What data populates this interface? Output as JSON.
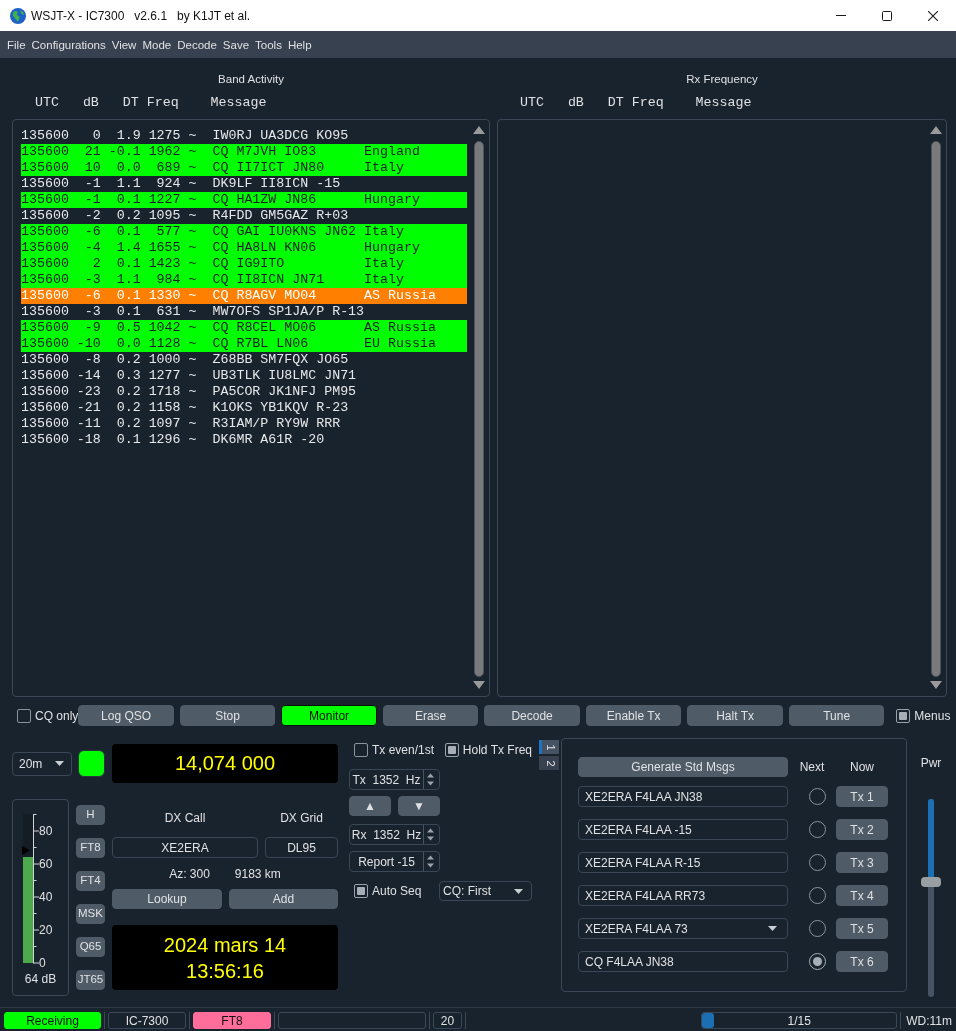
{
  "window": {
    "title": "WSJT-X - IC7300   v2.6.1   by K1JT et al."
  },
  "menu": [
    "File",
    "Configurations",
    "View",
    "Mode",
    "Decode",
    "Save",
    "Tools",
    "Help"
  ],
  "band_activity": {
    "title": "Band Activity",
    "columns": [
      "UTC",
      "dB",
      "DT",
      "Freq",
      "Message"
    ],
    "rows": [
      {
        "utc": "135600",
        "db": "0",
        "dt": "1.9",
        "freq": "1275",
        "mode": "~",
        "message": "IW0RJ UA3DCG KO95"
      },
      {
        "utc": "135600",
        "db": "21",
        "dt": "-0.1",
        "freq": "1962",
        "mode": "~",
        "message": "CQ M7JVH IO83",
        "country": "England",
        "color": "#00ff00"
      },
      {
        "utc": "135600",
        "db": "10",
        "dt": "0.0",
        "freq": "689",
        "mode": "~",
        "message": "CQ II7ICT JN80",
        "country": "Italy",
        "color": "#00ff00"
      },
      {
        "utc": "135600",
        "db": "-1",
        "dt": "1.1",
        "freq": "924",
        "mode": "~",
        "message": "DK9LF II8ICN -15"
      },
      {
        "utc": "135600",
        "db": "-1",
        "dt": "0.1",
        "freq": "1227",
        "mode": "~",
        "message": "CQ HA1ZW JN86",
        "country": "Hungary",
        "color": "#00ff00"
      },
      {
        "utc": "135600",
        "db": "-2",
        "dt": "0.2",
        "freq": "1095",
        "mode": "~",
        "message": "R4FDD GM5GAZ R+03"
      },
      {
        "utc": "135600",
        "db": "-6",
        "dt": "0.1",
        "freq": "577",
        "mode": "~",
        "message": "CQ GAI IU0KNS JN62",
        "country": "Italy",
        "color": "#00ff00"
      },
      {
        "utc": "135600",
        "db": "-4",
        "dt": "1.4",
        "freq": "1655",
        "mode": "~",
        "message": "CQ HA8LN KN06",
        "country": "Hungary",
        "color": "#00ff00"
      },
      {
        "utc": "135600",
        "db": "2",
        "dt": "0.1",
        "freq": "1423",
        "mode": "~",
        "message": "CQ IG9ITO",
        "country": "Italy",
        "color": "#00ff00"
      },
      {
        "utc": "135600",
        "db": "-3",
        "dt": "1.1",
        "freq": "984",
        "mode": "~",
        "message": "CQ II8ICN JN71",
        "country": "Italy",
        "color": "#00ff00"
      },
      {
        "utc": "135600",
        "db": "-6",
        "dt": "0.1",
        "freq": "1330",
        "mode": "~",
        "message": "CQ R8AGV MO04",
        "country": "AS Russia",
        "color": "#ff8000"
      },
      {
        "utc": "135600",
        "db": "-3",
        "dt": "0.1",
        "freq": "631",
        "mode": "~",
        "message": "MW7OFS SP1JA/P R-13"
      },
      {
        "utc": "135600",
        "db": "-9",
        "dt": "0.5",
        "freq": "1042",
        "mode": "~",
        "message": "CQ R8CEL MO06",
        "country": "AS Russia",
        "color": "#00ff00"
      },
      {
        "utc": "135600",
        "db": "-10",
        "dt": "0.0",
        "freq": "1128",
        "mode": "~",
        "message": "CQ R7BL LN06",
        "country": "EU Russia",
        "color": "#00ff00"
      },
      {
        "utc": "135600",
        "db": "-8",
        "dt": "0.2",
        "freq": "1000",
        "mode": "~",
        "message": "Z68BB SM7FQX JO65"
      },
      {
        "utc": "135600",
        "db": "-14",
        "dt": "0.3",
        "freq": "1277",
        "mode": "~",
        "message": "UB3TLK IU8LMC JN71"
      },
      {
        "utc": "135600",
        "db": "-23",
        "dt": "0.2",
        "freq": "1718",
        "mode": "~",
        "message": "PA5COR JK1NFJ PM95"
      },
      {
        "utc": "135600",
        "db": "-21",
        "dt": "0.2",
        "freq": "1158",
        "mode": "~",
        "message": "K1OKS YB1KQV R-23"
      },
      {
        "utc": "135600",
        "db": "-11",
        "dt": "0.2",
        "freq": "1097",
        "mode": "~",
        "message": "R3IAM/P RY9W RRR"
      },
      {
        "utc": "135600",
        "db": "-18",
        "dt": "0.1",
        "freq": "1296",
        "mode": "~",
        "message": "DK6MR A61R -20"
      }
    ]
  },
  "rx_frequency": {
    "title": "Rx Frequency",
    "columns": [
      "UTC",
      "dB",
      "DT",
      "Freq",
      "Message"
    ]
  },
  "toolbar": {
    "cq_only": {
      "label": "CQ only",
      "checked": false
    },
    "buttons": [
      {
        "label": "Log QSO",
        "on": false
      },
      {
        "label": "Stop",
        "on": false
      },
      {
        "label": "Monitor",
        "on": true
      },
      {
        "label": "Erase",
        "on": false
      },
      {
        "label": "Decode",
        "on": false
      },
      {
        "label": "Enable Tx",
        "on": false
      },
      {
        "label": "Halt Tx",
        "on": false
      },
      {
        "label": "Tune",
        "on": false
      }
    ],
    "menus": {
      "label": "Menus",
      "checked": true
    }
  },
  "band": {
    "value": "20m"
  },
  "rig_indicator": {
    "on": true
  },
  "dial_frequency": "14,074 000",
  "signal_meter": {
    "level": 0.71,
    "scale": [
      "80",
      "60",
      "40",
      "20",
      "0"
    ],
    "reading": "64 dB"
  },
  "modes": [
    "H",
    "FT8",
    "FT4",
    "MSK",
    "Q65",
    "JT65"
  ],
  "dx": {
    "call_label": "DX Call",
    "grid_label": "DX Grid",
    "call": "XE2ERA",
    "grid": "DL95",
    "azimuth": "Az: 300",
    "distance": "9183 km",
    "lookup": "Lookup",
    "add": "Add"
  },
  "clock": {
    "date": "2024 mars 14",
    "time": "13:56:16"
  },
  "tx_controls": {
    "tx_even": {
      "label": "Tx even/1st",
      "checked": false
    },
    "hold_tx_freq": {
      "label": "Hold Tx Freq",
      "checked": true
    },
    "tx_freq": "Tx  1352  Hz",
    "step_buttons": [
      "▲",
      "▼"
    ],
    "rx_freq": "Rx  1352  Hz",
    "report": "Report -15",
    "auto_seq": {
      "label": "Auto Seq",
      "checked": true
    },
    "cq_mode": "CQ: First"
  },
  "tabs": [
    {
      "label": "1",
      "selected": true
    },
    {
      "label": "2",
      "selected": false
    }
  ],
  "messages": {
    "generate": "Generate Std Msgs",
    "next_label": "Next",
    "now_label": "Now",
    "rows": [
      {
        "kind": "field",
        "text": "XE2ERA F4LAA JN38",
        "selected": false,
        "button": "Tx 1"
      },
      {
        "kind": "field",
        "text": "XE2ERA F4LAA -15",
        "selected": false,
        "button": "Tx 2"
      },
      {
        "kind": "field",
        "text": "XE2ERA F4LAA R-15",
        "selected": false,
        "button": "Tx 3"
      },
      {
        "kind": "field",
        "text": "XE2ERA F4LAA RR73",
        "selected": false,
        "button": "Tx 4"
      },
      {
        "kind": "dropdown",
        "text": "XE2ERA F4LAA 73",
        "selected": false,
        "button": "Tx 5"
      },
      {
        "kind": "field",
        "text": "CQ F4LAA JN38",
        "selected": true,
        "button": "Tx 6"
      }
    ]
  },
  "power": {
    "label": "Pwr",
    "level": 0.58
  },
  "status_bar": [
    {
      "kind": "label",
      "text": "Receiving",
      "color": "#00ff00"
    },
    {
      "kind": "label",
      "text": "IC-7300"
    },
    {
      "kind": "label",
      "text": "FT8",
      "color": "#ff6e9b"
    },
    {
      "kind": "blank"
    },
    {
      "kind": "label",
      "text": "20"
    },
    {
      "kind": "progress",
      "text": "1/15",
      "level": 0.06
    },
    {
      "kind": "plain",
      "text": "WD:11m"
    }
  ]
}
